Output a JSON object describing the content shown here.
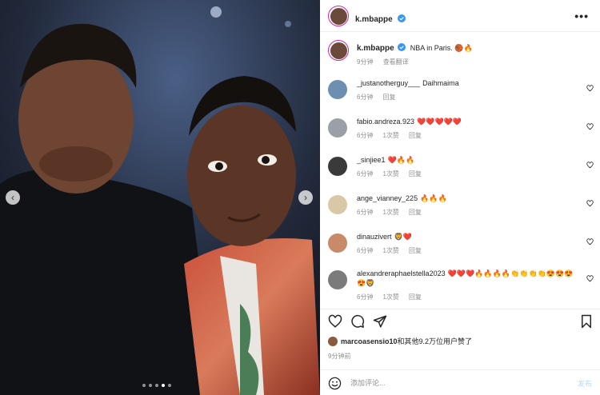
{
  "post": {
    "username": "k.mbappe",
    "more_label": "•••",
    "caption_text": "NBA in Paris.",
    "caption_time": "9分钟",
    "caption_translate": "查看翻译",
    "carousel": {
      "prev": "‹",
      "next": "›",
      "slide_count": 5,
      "active_slide": 4
    }
  },
  "comments": [
    {
      "user": "_justanotherguy___",
      "text": "Daihmaima",
      "time": "6分钟",
      "likes": "",
      "reply": "回复",
      "avatar_color": "#6e8fb0"
    },
    {
      "user": "fabio.andreza.923",
      "text": "❤️❤️❤️❤️❤️",
      "time": "6分钟",
      "likes": "1次赞",
      "reply": "回复",
      "avatar_color": "#9aa0a6"
    },
    {
      "user": "_sinjiee1",
      "text": "❤️🔥🔥",
      "time": "6分钟",
      "likes": "1次赞",
      "reply": "回复",
      "avatar_color": "#3a3a3a"
    },
    {
      "user": "ange_vianney_225",
      "text": "🔥🔥🔥",
      "time": "6分钟",
      "likes": "1次赞",
      "reply": "回复",
      "avatar_color": "#d9c8a8"
    },
    {
      "user": "dinauzivert",
      "text": "🦁❤️",
      "time": "6分钟",
      "likes": "1次赞",
      "reply": "回复",
      "avatar_color": "#c98a6a"
    },
    {
      "user": "alexandreraphaelstella2023",
      "text": "❤️❤️❤️🔥🔥🔥🔥👏👏👏👏😍😍😍😍🦁",
      "time": "6分钟",
      "likes": "1次赞",
      "reply": "回复",
      "avatar_color": "#7b7b7b"
    }
  ],
  "likes": {
    "user": "marcoasensio10",
    "rest": "和其他9.2万位用户赞了"
  },
  "time_ago": "9分钟前",
  "add_comment": {
    "placeholder": "添加评论...",
    "post_label": "发布"
  },
  "icons": {
    "verified": "verified-badge-icon",
    "heart": "heart-icon",
    "comment": "comment-icon",
    "share": "share-icon",
    "save": "bookmark-icon",
    "emoji": "emoji-icon"
  },
  "colors": {
    "verified": "#3897f0",
    "post_button": "#b3dbff",
    "secondary_text": "#8e8e8e",
    "story_ring": "#d6249f"
  }
}
